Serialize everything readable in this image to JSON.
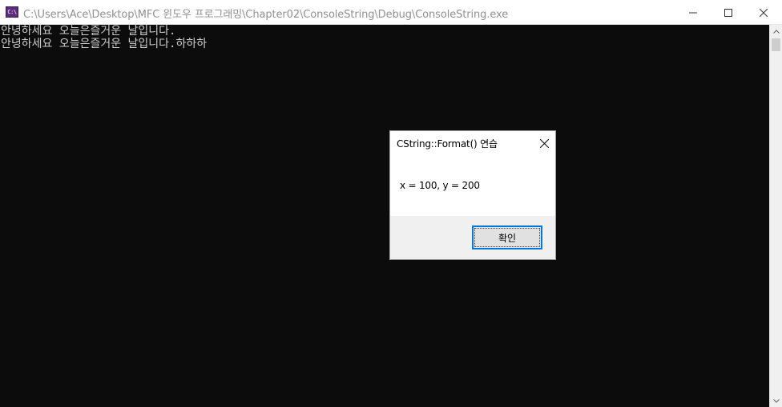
{
  "window": {
    "title": "C:\\Users\\Ace\\Desktop\\MFC 윈도우 프로그래밍\\Chapter02\\ConsoleString\\Debug\\ConsoleString.exe",
    "icon": "console-app-icon",
    "icon_text": "C:\\",
    "buttons": {
      "minimize": "minimize-icon",
      "maximize": "maximize-icon",
      "close": "close-icon"
    }
  },
  "console": {
    "lines": [
      "안녕하세요 오늘은즐거운 날입니다.",
      "안녕하세요 오늘은즐거운 날입니다.하하하"
    ],
    "background": "#0c0c0c",
    "foreground": "#cccccc"
  },
  "message_box": {
    "title": "CString::Format() 연습",
    "message": "x = 100, y = 200",
    "ok_label": "확인",
    "close_icon": "close-icon",
    "accent": "#0078d7"
  }
}
